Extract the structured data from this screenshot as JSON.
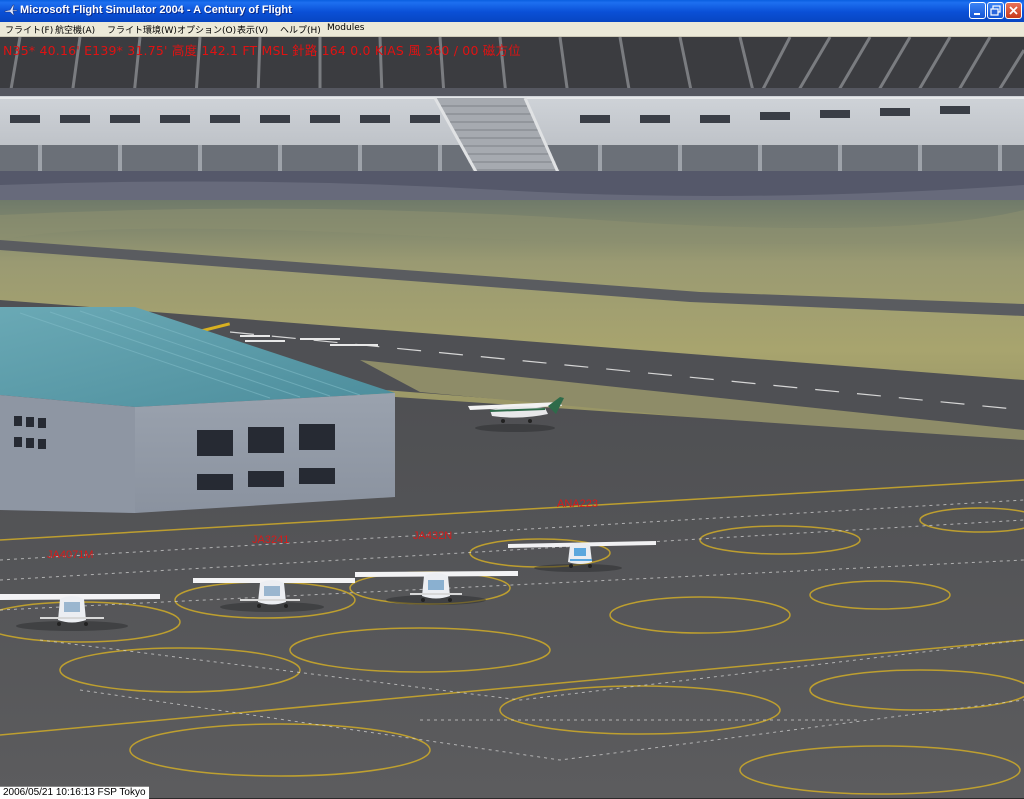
{
  "window": {
    "title": "Microsoft Flight Simulator 2004 - A Century of Flight",
    "controls": {
      "minimize": "minimize",
      "maximize": "maximize",
      "close": "close"
    }
  },
  "menu": [
    "フライト(F)",
    "航空機(A)",
    "フライト環境(W)",
    "オプション(O)",
    "表示(V)",
    "ヘルプ(H)",
    "Modules"
  ],
  "hud": {
    "text": "N35* 40.16'  E139* 31.75'  高度  142.1 FT  MSL  針路 164   0.0 KIAS  風 360 / 00 磁方位"
  },
  "aircraft_labels": [
    "JA4071M",
    "JA3241",
    "JA432N",
    "ANA223"
  ],
  "status": {
    "text": "2006/05/21 10:16:13 FSP Tokyo"
  },
  "colors": {
    "title_bar": "#0a4fd6",
    "menu_bg": "#ece9d8",
    "hud_text": "#e01212",
    "hangar_roof": "#5a9aa8",
    "apron": "#5a5a5c"
  }
}
